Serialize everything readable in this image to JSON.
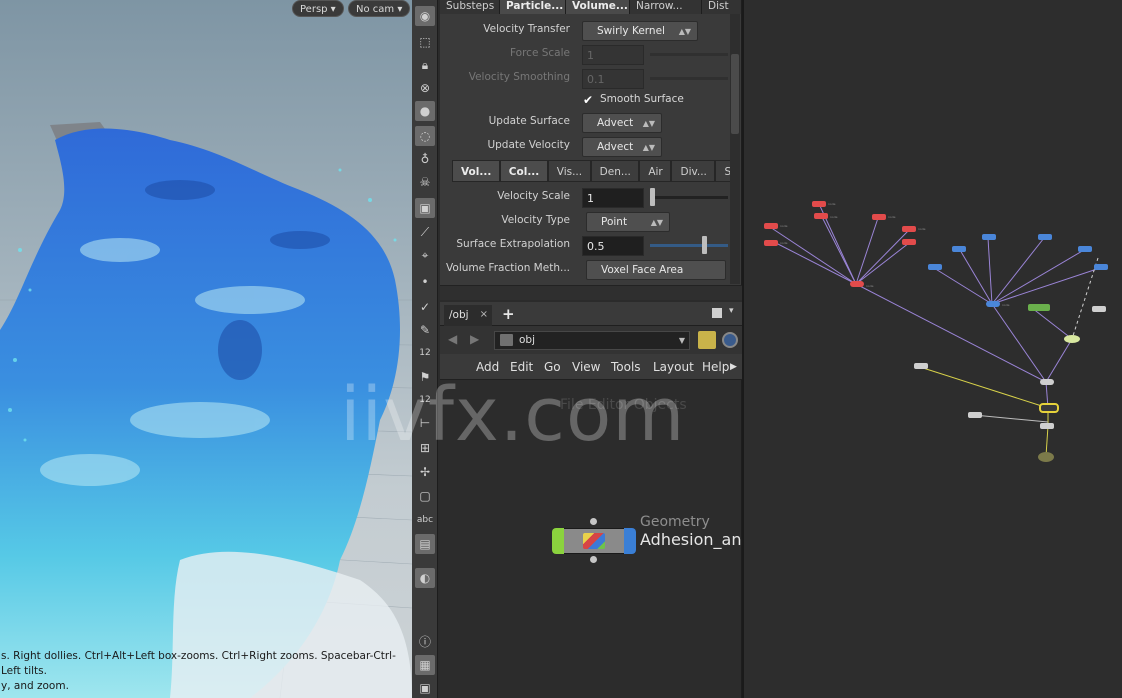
{
  "viewport": {
    "persp_label": "Persp",
    "cam_label": "No cam",
    "status_line1": "s. Right dollies. Ctrl+Alt+Left box-zooms. Ctrl+Right zooms. Spacebar-Ctrl-Left tilts.",
    "status_line2": "y, and zoom."
  },
  "toolbar": {
    "icons": [
      "view-icon",
      "select-icon",
      "lock-icon",
      "snap-icon",
      "sphere-icon",
      "light-icon",
      "pin-icon",
      "skull-icon",
      "ghost-icon",
      "bone-icon",
      "handle-icon",
      "dot-icon",
      "brush-icon",
      "pen-icon",
      "number-icon",
      "flag-icon",
      "number-icon",
      "rotate-icon",
      "grid-icon",
      "wand-icon",
      "square-icon",
      "text-icon",
      "camera-icon",
      "snapshot-icon",
      "info-icon",
      "layout-icon",
      "render-icon"
    ],
    "text_12a": "12",
    "text_12b": "12",
    "text_abc": "abc"
  },
  "params": {
    "top_tabs": [
      "Substeps",
      "Particle...",
      "Volume...",
      "Narrow...",
      "Dist"
    ],
    "velocity_transfer": {
      "label": "Velocity Transfer",
      "value": "Swirly Kernel"
    },
    "force_scale": {
      "label": "Force Scale",
      "value": "1"
    },
    "velocity_smoothing": {
      "label": "Velocity Smoothing",
      "value": "0.1"
    },
    "smooth_surface": {
      "label": "Smooth Surface",
      "checked": "✔"
    },
    "update_surface": {
      "label": "Update Surface",
      "value": "Advect"
    },
    "update_velocity": {
      "label": "Update Velocity",
      "value": "Advect"
    },
    "sub_tabs": [
      "Vol...",
      "Col...",
      "Vis...",
      "Den...",
      "Air",
      "Div...",
      "S"
    ],
    "velocity_scale": {
      "label": "Velocity Scale",
      "value": "1"
    },
    "velocity_type": {
      "label": "Velocity Type",
      "value": "Point"
    },
    "surface_extrapolation": {
      "label": "Surface Extrapolation",
      "value": "0.5"
    },
    "volume_fraction": {
      "label": "Volume Fraction Meth...",
      "value": "Voxel Face Area"
    }
  },
  "network": {
    "path_tab": "/obj",
    "path_value": "obj",
    "menu": [
      "Add",
      "Edit",
      "Go",
      "View",
      "Tools",
      "Layout",
      "Help"
    ],
    "context_title": "File Editor  Objects",
    "node_type": "Geometry",
    "node_name": "Adhesion_and"
  },
  "watermark": "iivfx.com",
  "colors": {
    "node_red": "#e24b4b",
    "node_blue": "#4a86d9",
    "node_green": "#6ab04c",
    "wire_purple": "#9a84d6",
    "wire_yellow": "#d8d24a"
  }
}
